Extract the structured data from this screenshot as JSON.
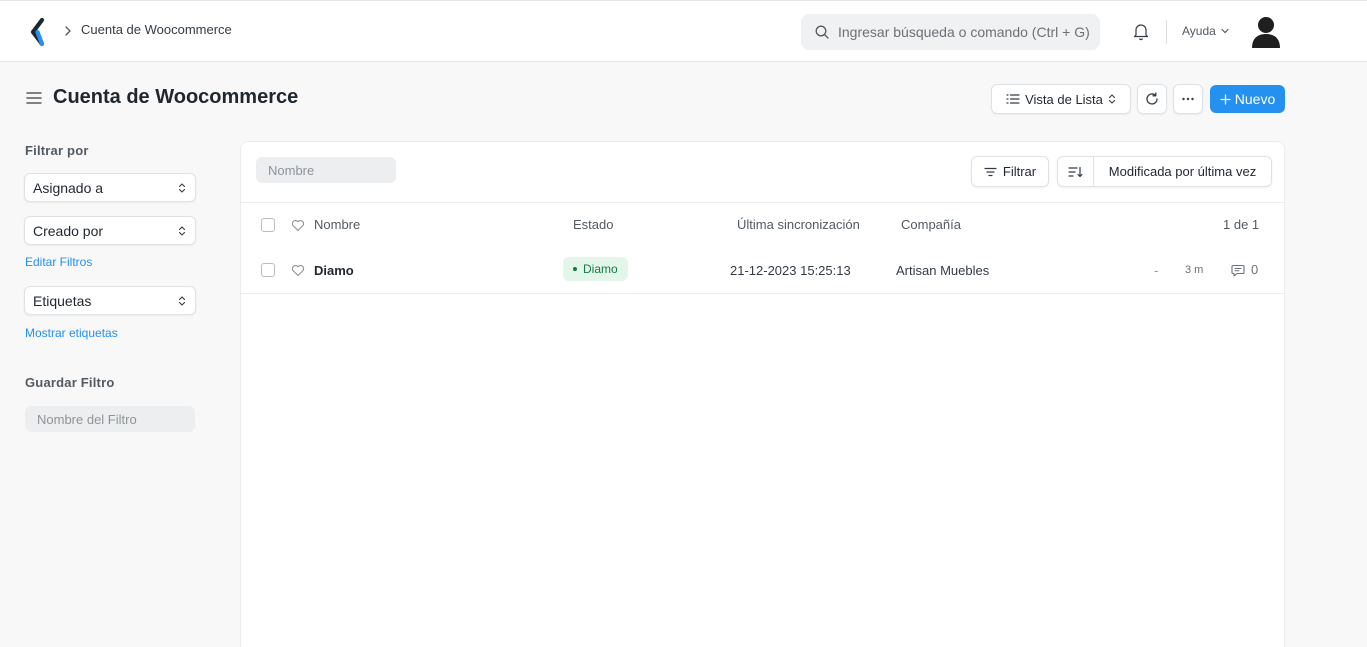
{
  "navbar": {
    "breadcrumb": "Cuenta de Woocommerce",
    "search_placeholder": "Ingresar búsqueda o comando (Ctrl + G)",
    "help_label": "Ayuda"
  },
  "page": {
    "title": "Cuenta de Woocommerce",
    "view_label": "Vista de Lista",
    "new_label": "Nuevo"
  },
  "sidebar": {
    "filter_by_label": "Filtrar por",
    "assigned_to": "Asignado a",
    "created_by": "Creado por",
    "edit_filters": "Editar Filtros",
    "tags": "Etiquetas",
    "show_tags": "Mostrar etiquetas",
    "save_filter_label": "Guardar Filtro",
    "filter_name_placeholder": "Nombre del Filtro"
  },
  "list": {
    "name_filter_placeholder": "Nombre",
    "filter_label": "Filtrar",
    "sort_label": "Modificada por última vez",
    "columns": {
      "name": "Nombre",
      "status": "Estado",
      "last_sync": "Última sincronización",
      "company": "Compañía",
      "count": "1 de 1"
    },
    "rows": [
      {
        "name": "Diamo",
        "status": "Diamo",
        "last_sync": "21-12-2023 15:25:13",
        "company": "Artisan Muebles",
        "assigned": "-",
        "modified": "3 m",
        "comments": "0"
      }
    ]
  },
  "colors": {
    "primary": "#2490ef",
    "status_bg": "#e4f5e9",
    "status_text": "#16794c"
  }
}
